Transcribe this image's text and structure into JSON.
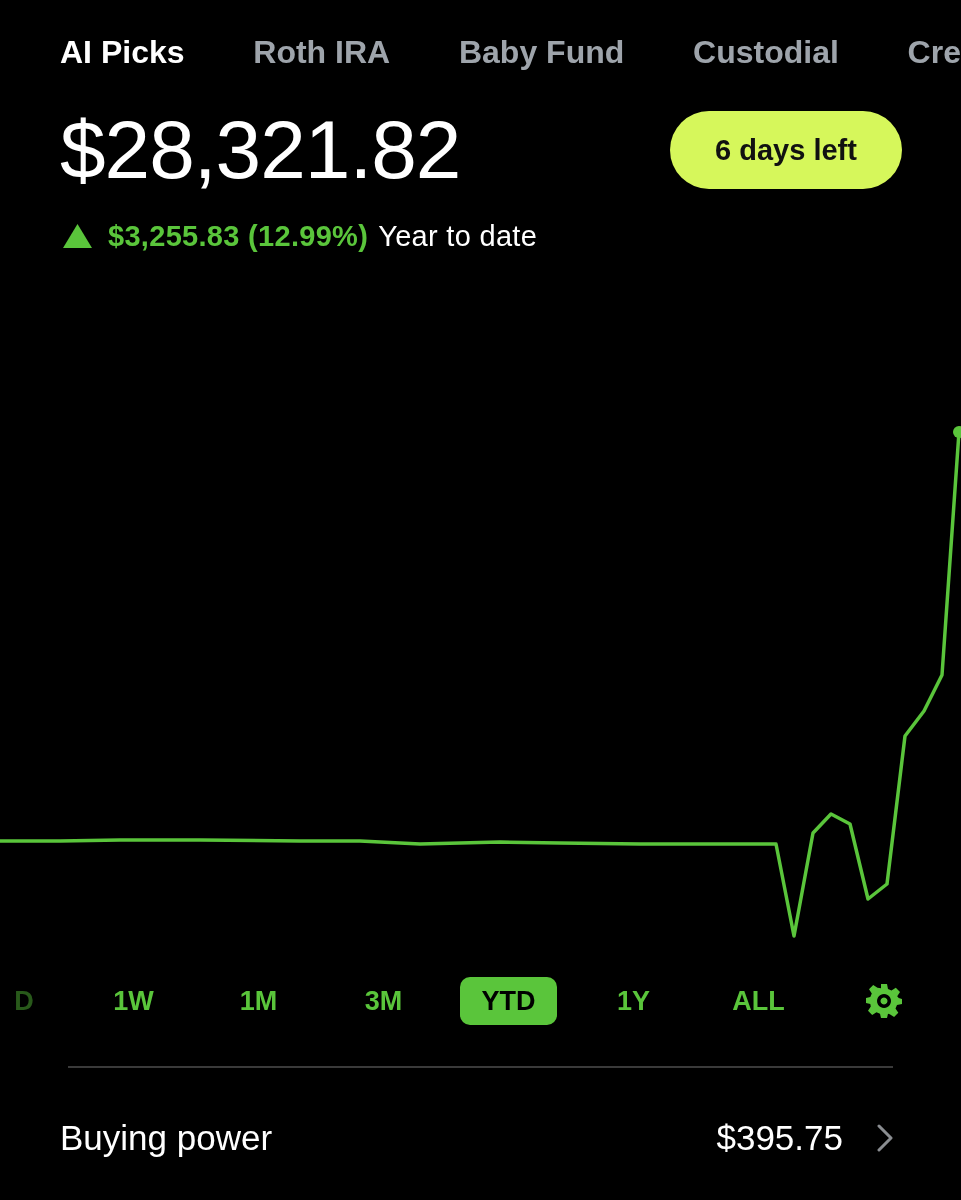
{
  "account_tabs": [
    {
      "label": "AI Picks",
      "selected": true
    },
    {
      "label": "Roth IRA",
      "selected": false
    },
    {
      "label": "Baby Fund",
      "selected": false
    },
    {
      "label": "Custodial",
      "selected": false
    },
    {
      "label": "Cre",
      "selected": false
    }
  ],
  "portfolio": {
    "value": "$28,321.82",
    "badge": "6 days left",
    "change": {
      "positive": true,
      "amount": "$3,255.83 (12.99%)",
      "period": "Year to date"
    }
  },
  "time_ranges": [
    {
      "label": "D",
      "selected": false
    },
    {
      "label": "1W",
      "selected": false
    },
    {
      "label": "1M",
      "selected": false
    },
    {
      "label": "3M",
      "selected": false
    },
    {
      "label": "YTD",
      "selected": true
    },
    {
      "label": "1Y",
      "selected": false
    },
    {
      "label": "ALL",
      "selected": false
    }
  ],
  "buying_power": {
    "label": "Buying power",
    "value": "$395.75"
  }
}
